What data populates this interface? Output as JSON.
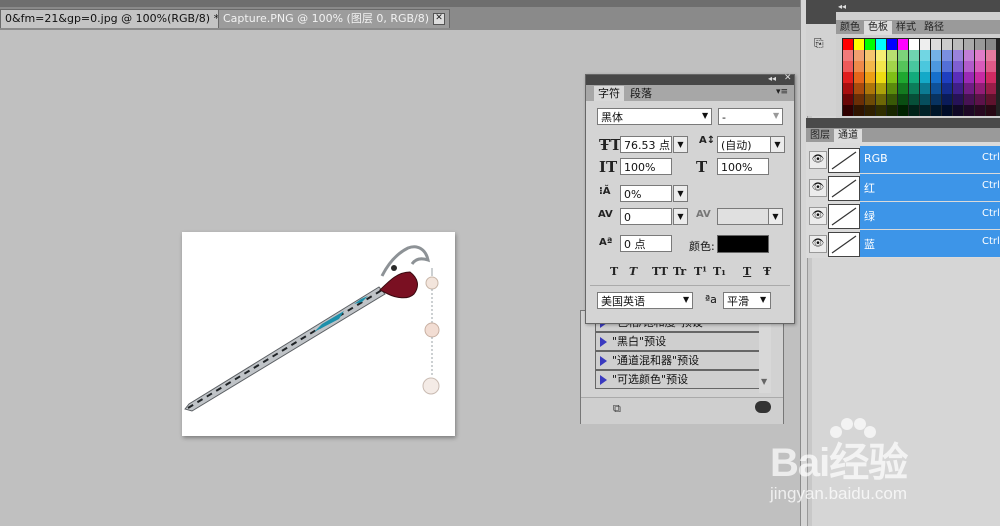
{
  "document_tabs": [
    {
      "label": "0&fm=21&gp=0.jpg @ 100%(RGB/8) *",
      "active": true
    },
    {
      "label": "Capture.PNG @ 100% (图层 0, RGB/8)",
      "active": false
    }
  ],
  "swatches_panel": {
    "tabs": [
      "颜色",
      "色板",
      "样式",
      "路径"
    ],
    "active_tab": "色板"
  },
  "channels_panel": {
    "tabs": [
      "图层",
      "通道"
    ],
    "active_tab": "通道",
    "channels": [
      {
        "name": "RGB",
        "shortcut": "Ctrl+"
      },
      {
        "name": "红",
        "shortcut": "Ctrl+"
      },
      {
        "name": "绿",
        "shortcut": "Ctrl+"
      },
      {
        "name": "蓝",
        "shortcut": "Ctrl+"
      }
    ],
    "highlight_color": "#3d95e8"
  },
  "character_panel": {
    "tabs": [
      "字符",
      "段落"
    ],
    "active_tab": "字符",
    "font_family": "黑体",
    "font_style": "-",
    "font_size": "76.53 点",
    "leading": "(自动)",
    "vertical_scale": "100%",
    "horizontal_scale": "100%",
    "tracking_ratio": "0%",
    "kerning": "0",
    "tracking": "",
    "baseline_shift": "0 点",
    "color_label": "颜色:",
    "text_color": "#000000",
    "language": "美国英语",
    "antialias_icon": "ªa",
    "antialias": "平滑",
    "format_buttons": [
      "T",
      "T",
      "TT",
      "Tr",
      "T¹",
      "T₁",
      "T",
      "Ŧ"
    ]
  },
  "adjustments_panel": {
    "presets": [
      "\"色相/饱和度\"预设",
      "\"黑白\"预设",
      "\"通道混和器\"预设",
      "\"可选颜色\"预设"
    ]
  },
  "watermark": {
    "brand": "Bai经验",
    "url": "jingyan.baidu.com"
  }
}
